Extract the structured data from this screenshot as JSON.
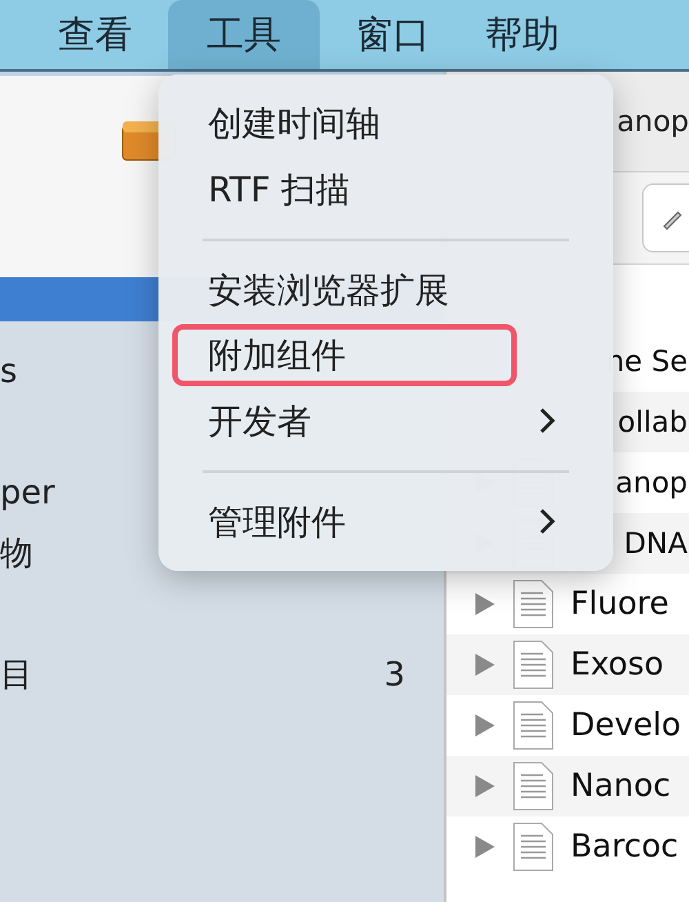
{
  "menubar": [
    {
      "label": "查看",
      "selected": false
    },
    {
      "label": "工具",
      "selected": true
    },
    {
      "label": "窗口",
      "selected": false
    },
    {
      "label": "帮助",
      "selected": false
    }
  ],
  "sidebar": {
    "items": [
      {
        "label": "s",
        "selected": false
      },
      {
        "label": "per",
        "selected": false
      },
      {
        "label": "物",
        "selected": false
      },
      {
        "label": "目",
        "count": "3",
        "selected": false
      }
    ]
  },
  "document": {
    "title": "anop"
  },
  "list": {
    "rows": [
      {
        "label": "ne Se"
      },
      {
        "label": "ollab"
      },
      {
        "label": "anop"
      },
      {
        "label": "DNA"
      },
      {
        "label": "Fluore"
      },
      {
        "label": "Exoso"
      },
      {
        "label": "Develo"
      },
      {
        "label": "Nanoc"
      },
      {
        "label": "Barcoc"
      }
    ]
  },
  "menu": {
    "items": [
      {
        "kind": "item",
        "label": "创建时间轴",
        "submenu": false,
        "highlighted": false
      },
      {
        "kind": "item",
        "label": "RTF 扫描",
        "submenu": false,
        "highlighted": false
      },
      {
        "kind": "separator"
      },
      {
        "kind": "item",
        "label": "安装浏览器扩展",
        "submenu": false,
        "highlighted": false
      },
      {
        "kind": "item",
        "label": "附加组件",
        "submenu": false,
        "highlighted": true
      },
      {
        "kind": "item",
        "label": "开发者",
        "submenu": true,
        "highlighted": false
      },
      {
        "kind": "separator"
      },
      {
        "kind": "item",
        "label": "管理附件",
        "submenu": true,
        "highlighted": false
      }
    ]
  }
}
